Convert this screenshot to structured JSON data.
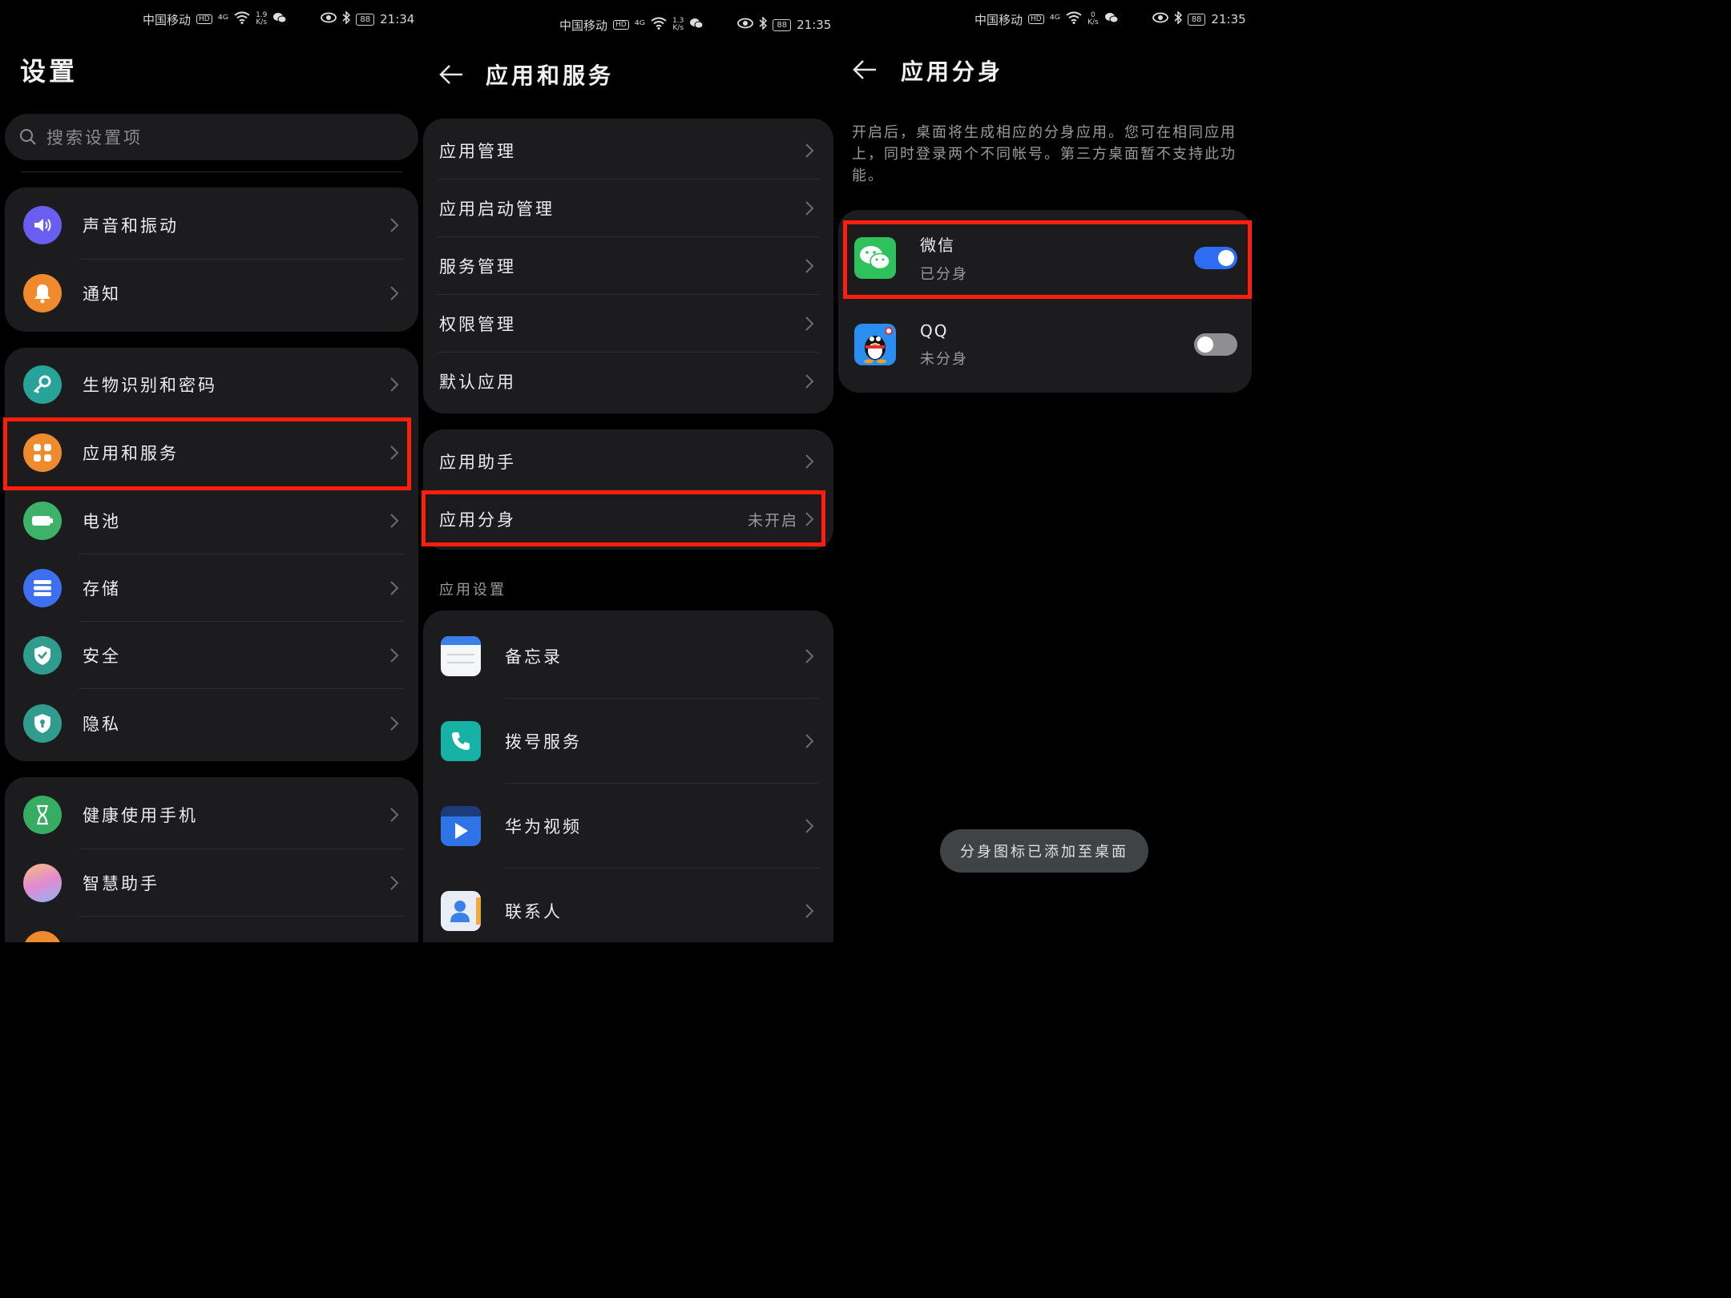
{
  "colors": {
    "background": "#000000",
    "card": "#1c1c1e",
    "highlight": "#ff1e0c",
    "toggle_on": "#2f6cf4",
    "toggle_off": "#8e8e93"
  },
  "screens": [
    {
      "status": {
        "carrier": "中国移动",
        "hd": "HD",
        "signal": "⁴ᴳ",
        "speed_value": "1.9",
        "speed_unit": "K/s",
        "battery": "88",
        "time": "21:34"
      },
      "title": "设置",
      "search_placeholder": "搜索设置项",
      "groups": [
        [
          {
            "label": "声音和振动",
            "icon": "speaker-icon",
            "color": "#6a5ef0"
          },
          {
            "label": "通知",
            "icon": "bell-icon",
            "color": "#f08a2c"
          }
        ],
        [
          {
            "label": "生物识别和密码",
            "icon": "key-icon",
            "color": "#27a39a"
          },
          {
            "label": "应用和服务",
            "icon": "apps-grid-icon",
            "color": "#ef8a2f"
          },
          {
            "label": "电池",
            "icon": "battery-icon",
            "color": "#3fb26a"
          },
          {
            "label": "存储",
            "icon": "storage-icon",
            "color": "#3d6ff0"
          },
          {
            "label": "安全",
            "icon": "shield-icon",
            "color": "#2f9c8e"
          },
          {
            "label": "隐私",
            "icon": "privacy-shield-icon",
            "color": "#2f9c8e"
          }
        ],
        [
          {
            "label": "健康使用手机",
            "icon": "hourglass-icon",
            "color": "#36ad63"
          },
          {
            "label": "智慧助手",
            "icon": "assistant-icon",
            "color": "#c98be0"
          }
        ]
      ]
    },
    {
      "status": {
        "carrier": "中国移动",
        "hd": "HD",
        "signal": "⁴ᴳ",
        "speed_value": "1.3",
        "speed_unit": "K/s",
        "battery": "88",
        "time": "21:35"
      },
      "title": "应用和服务",
      "group1": [
        {
          "label": "应用管理"
        },
        {
          "label": "应用启动管理"
        },
        {
          "label": "服务管理"
        },
        {
          "label": "权限管理"
        },
        {
          "label": "默认应用"
        }
      ],
      "group2": [
        {
          "label": "应用助手",
          "value": ""
        },
        {
          "label": "应用分身",
          "value": "未开启"
        }
      ],
      "section_header": "应用设置",
      "apps": [
        {
          "label": "备忘录",
          "icon": "memo-icon"
        },
        {
          "label": "拨号服务",
          "icon": "phone-icon"
        },
        {
          "label": "华为视频",
          "icon": "video-icon"
        },
        {
          "label": "联系人",
          "icon": "contacts-icon"
        }
      ]
    },
    {
      "status": {
        "carrier": "中国移动",
        "hd": "HD",
        "signal": "⁴ᴳ",
        "speed_value": "0",
        "speed_unit": "K/s",
        "battery": "88",
        "time": "21:35"
      },
      "title": "应用分身",
      "description": "开启后，桌面将生成相应的分身应用。您可在相同应用上，同时登录两个不同帐号。第三方桌面暂不支持此功能。",
      "apps": [
        {
          "name": "微信",
          "status": "已分身",
          "enabled": true,
          "icon": "wechat-icon"
        },
        {
          "name": "QQ",
          "status": "未分身",
          "enabled": false,
          "icon": "qq-icon"
        }
      ],
      "toast": "分身图标已添加至桌面"
    }
  ]
}
